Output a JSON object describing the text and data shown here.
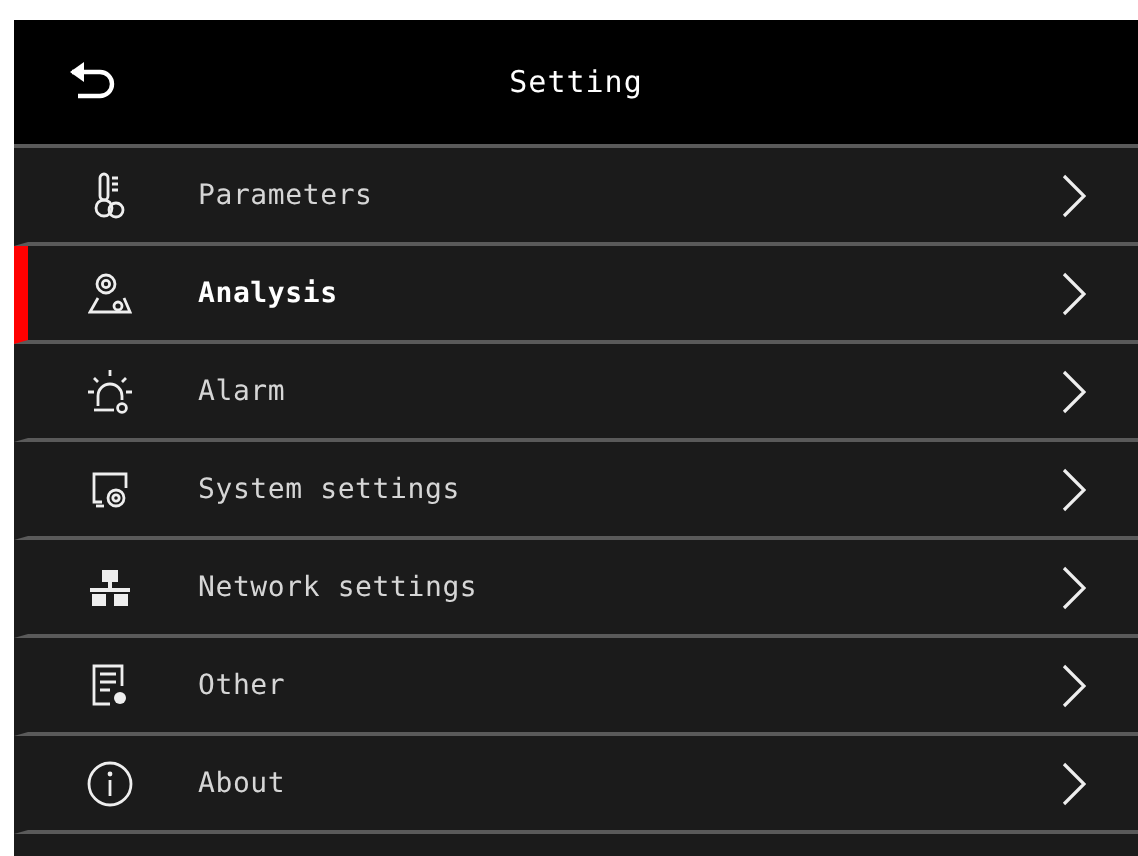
{
  "header": {
    "title": "Setting"
  },
  "items": [
    {
      "label": "Parameters",
      "selected": false
    },
    {
      "label": "Analysis",
      "selected": true
    },
    {
      "label": "Alarm",
      "selected": false
    },
    {
      "label": "System settings",
      "selected": false
    },
    {
      "label": "Network settings",
      "selected": false
    },
    {
      "label": "Other",
      "selected": false
    },
    {
      "label": "About",
      "selected": false
    }
  ]
}
